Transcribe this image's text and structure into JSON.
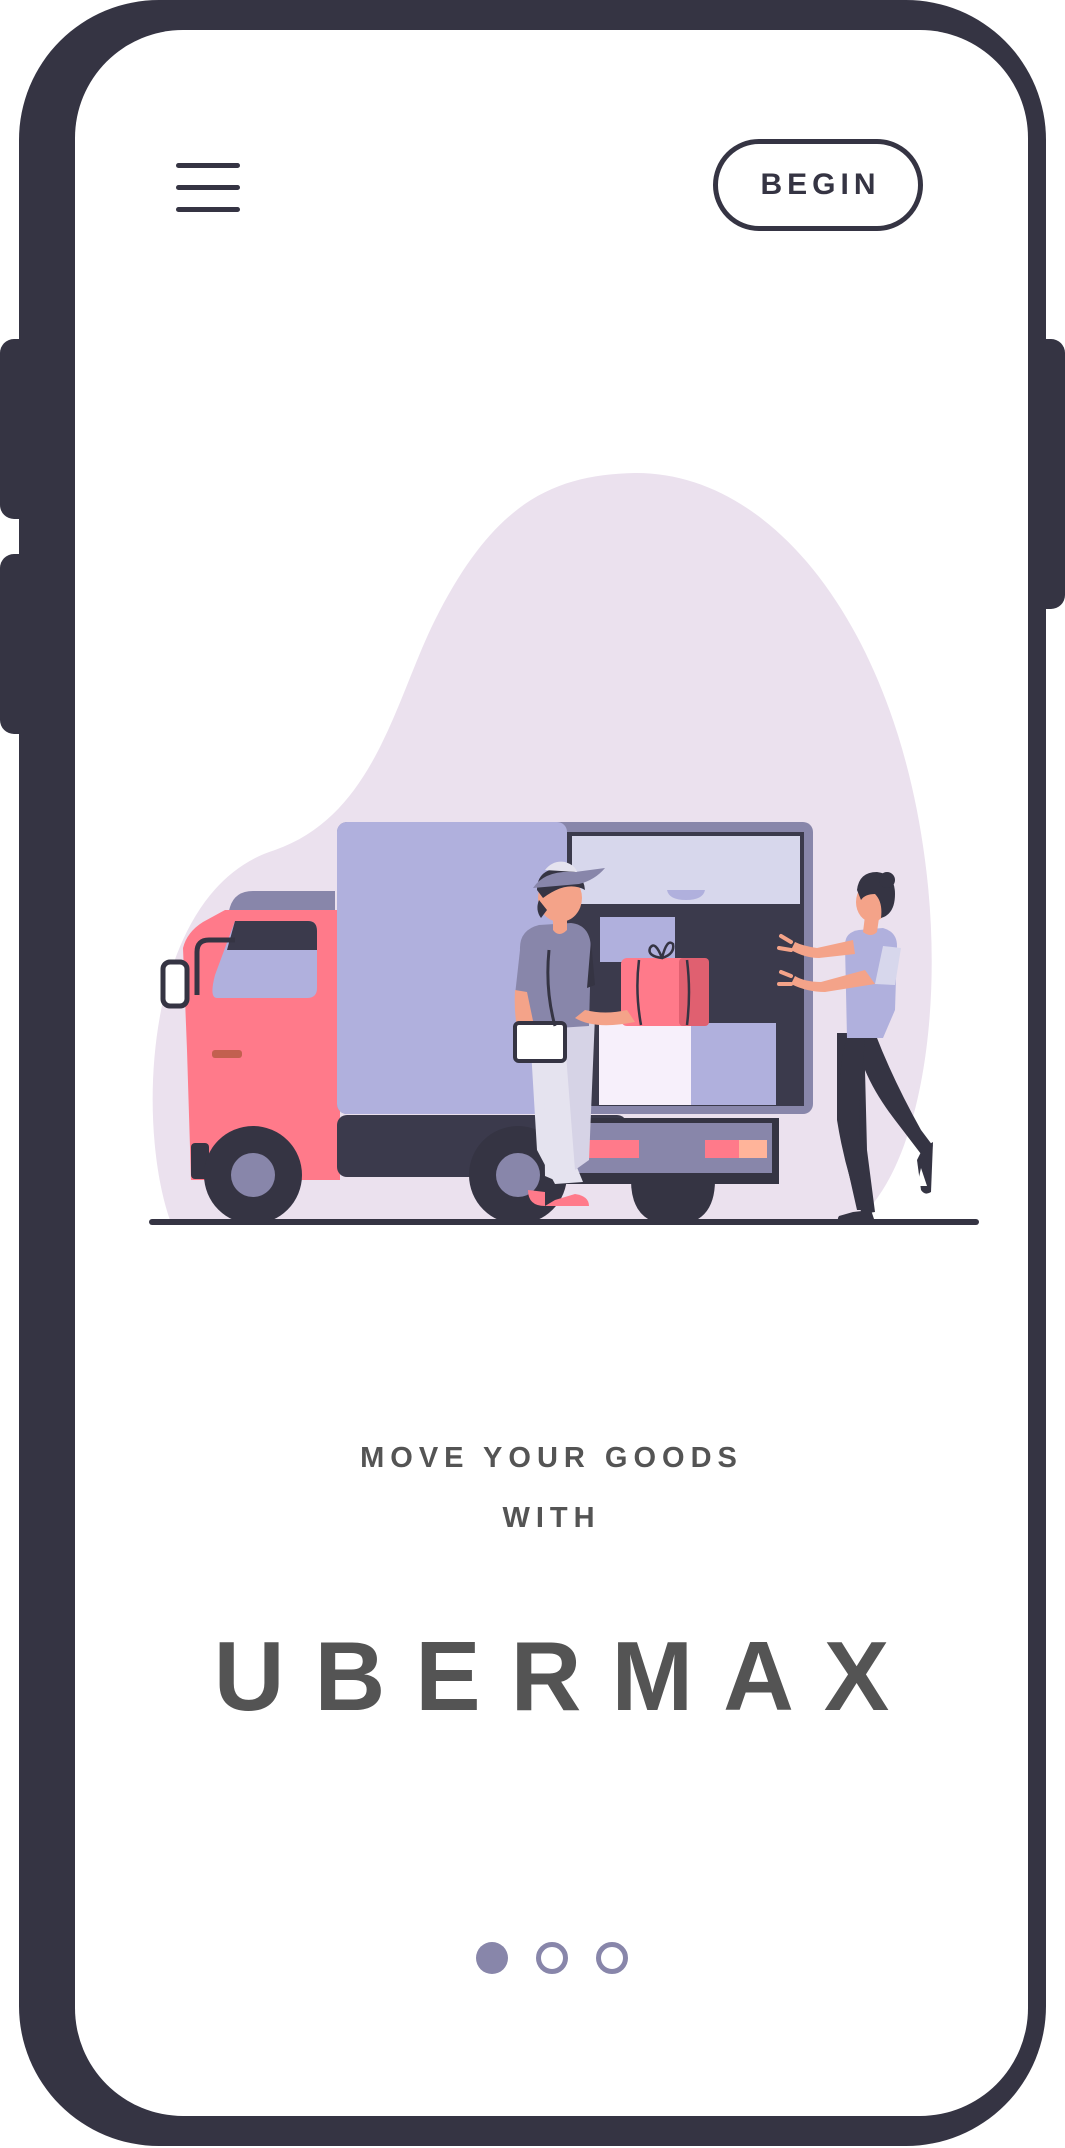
{
  "header": {
    "menu_icon": "hamburger-menu-icon",
    "begin_label": "BEGIN"
  },
  "hero": {
    "illustration": "delivery-truck-illustration",
    "tagline_line1": "MOVE YOUR GOODS",
    "tagline_line2": "WITH",
    "brand": "UBERMAX"
  },
  "pagination": {
    "total_pages": 3,
    "current_page": 1
  },
  "colors": {
    "frame": "#353443",
    "text": "#545454",
    "accent": "#8886aa",
    "blob": "#ebe1ee",
    "truck_cab": "#ff7a8a",
    "truck_box": "#b0b0dd"
  }
}
